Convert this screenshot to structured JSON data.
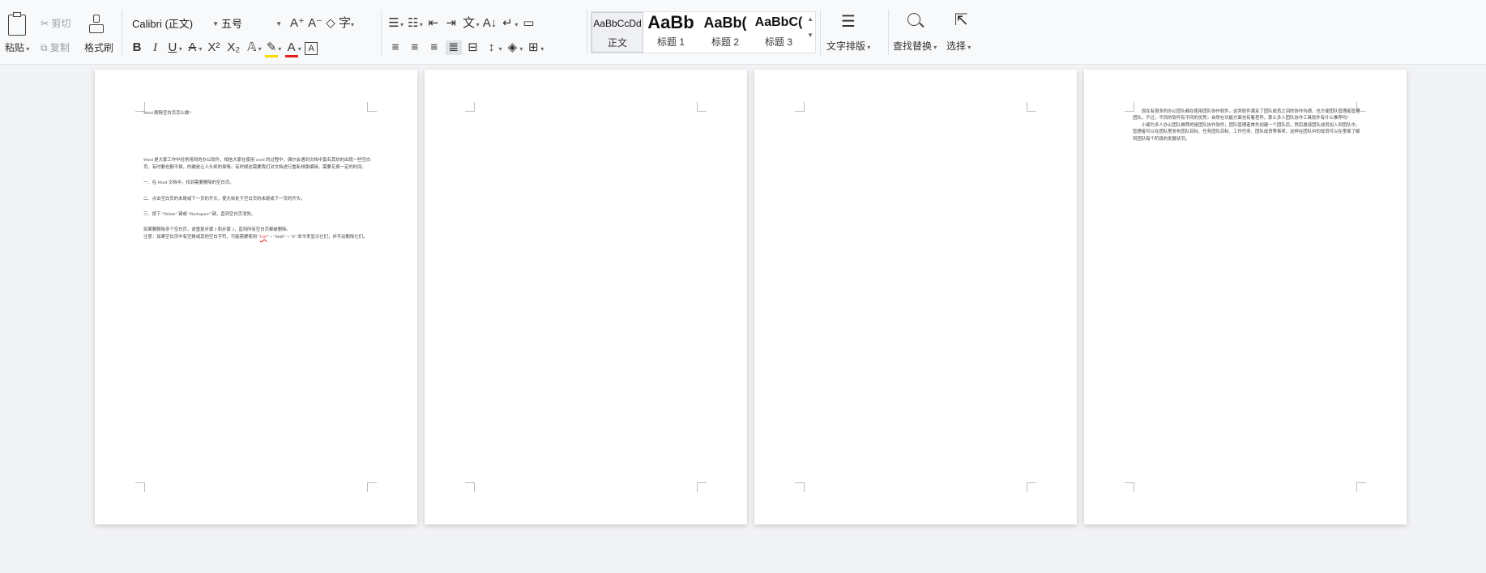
{
  "ribbon": {
    "clipboard": {
      "paste": "粘贴",
      "cut": "剪切",
      "copy": "复制",
      "format_painter": "格式刷"
    },
    "font": {
      "name": "Calibri (正文)",
      "size": "五号"
    },
    "styles": [
      {
        "sample": "AaBbCcDd",
        "label": "正文"
      },
      {
        "sample": "AaBb",
        "label": "标题 1"
      },
      {
        "sample": "AaBb(",
        "label": "标题 2"
      },
      {
        "sample": "AaBbC(",
        "label": "标题 3"
      }
    ],
    "text_layout": "文字排版",
    "find_replace": "查找替换",
    "select": "选择"
  },
  "pages": [
    {
      "title": "Word 删除空白页怎么做?",
      "para1": "Word 是大家工作中经常用到的办公软件，相信大家在使用 word 的过程中，偶尔会遇到文档中莫名其妙的出现一些空白页，有时删也删不掉，的确是让人头疼的事情。有时候这需要我们对文档进行重新排版编辑，需要花费一定的时间。",
      "step1": "一、在 Word 文档中，找到需要删除的空白页。",
      "step2": "二、点击空白页的末尾或下一页的开头，使光标处于空白页的末尾或下一页的开头。",
      "step3": "三、按下 “Delete” 键或 “Backspace” 键，直到空白页消失。",
      "note1": "如果要删除多个空白页，请重复步骤 2 和步骤 3，直到所有空白页都被删除。",
      "note2_a": "注意：如果空白页中有空格或其他空白字符，可能需要使用 “",
      "note2_ctrl": "Ctrl",
      "note2_b": "” + “Shift” + “8” 命令来显示它们，并手动删除它们。"
    },
    {},
    {},
    {
      "para1": "现在有很多的办公团队都在使用团队协作软件，这类软件满足了团队成员之间的协作沟通，也方便团队管理者管理团队。不过，不同的软件有不同的优势，自然在功能方面也有着差异，那么多人团队协作工具软件有什么推荐吗?",
      "para2": "小编为多人办公团队推荐的是团队协作软件，团队管理者首先创建一个团队后，然后邀请团队成员加入到团队中，管理者可以在团队里发布团队目标、任务团队目标、工作任务、团队成员等事项，这样在团队中的成员可以在里面了解到团队每个阶段的发展状况。"
    }
  ]
}
